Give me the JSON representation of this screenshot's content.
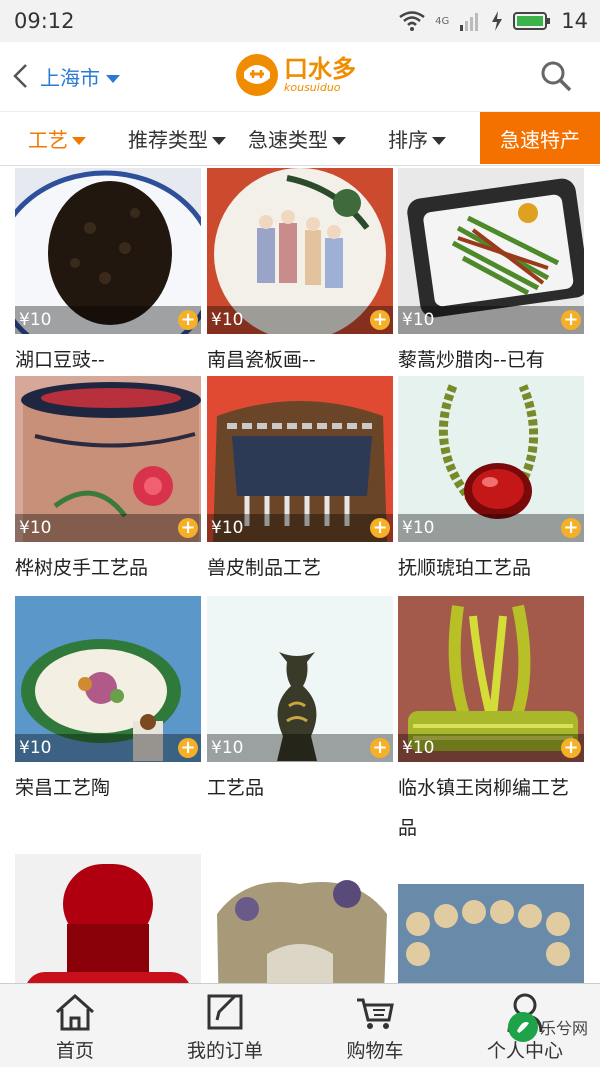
{
  "status": {
    "time": "09:12",
    "network": "4G",
    "battery": "14"
  },
  "header": {
    "city": "上海市",
    "logo_main": "口水多",
    "logo_sub": "kousuiduo"
  },
  "filters": {
    "craft": "工艺",
    "recommend": "推荐类型",
    "urgent": "急速类型",
    "sort": "排序",
    "special": "急速特产"
  },
  "products": [
    {
      "name": "湖口豆豉--",
      "price": "¥10"
    },
    {
      "name": "南昌瓷板画--",
      "price": "¥10"
    },
    {
      "name": "藜蒿炒腊肉--已有",
      "price": "¥10"
    },
    {
      "name": "桦树皮手工艺品",
      "price": "¥10"
    },
    {
      "name": "兽皮制品工艺",
      "price": "¥10"
    },
    {
      "name": "抚顺琥珀工艺品",
      "price": "¥10"
    },
    {
      "name": "荣昌工艺陶",
      "price": "¥10"
    },
    {
      "name": "工艺品",
      "price": "¥10"
    },
    {
      "name": "临水镇王岗柳编工艺品",
      "price": "¥10"
    }
  ],
  "tabs": {
    "home": "首页",
    "orders": "我的订单",
    "cart": "购物车",
    "profile": "个人中心"
  },
  "watermark": "乐兮网",
  "colors": {
    "accent": "#f07a00",
    "link": "#2b7ad1",
    "badge": "#f6b027"
  }
}
